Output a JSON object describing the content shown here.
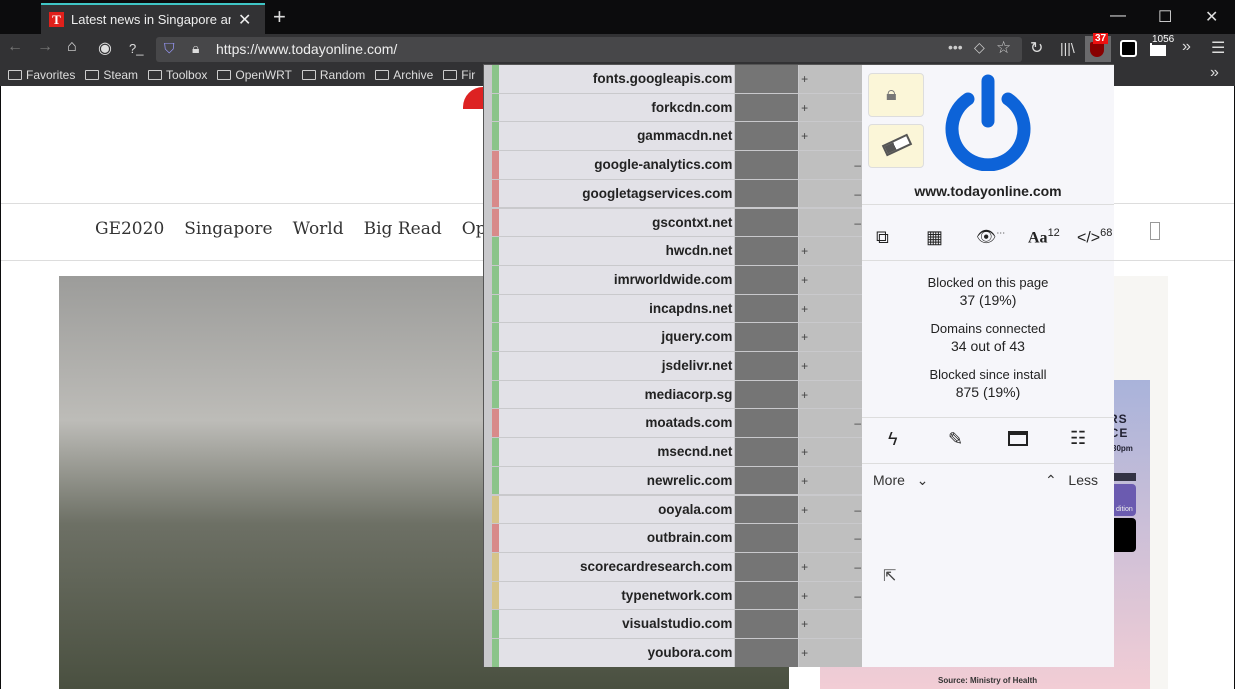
{
  "browser": {
    "tab_title": "Latest news in Singapore and around the world",
    "tab_favicon": "T",
    "url": "https://www.todayonline.com/",
    "ublock_badge": "37",
    "ext_badge": "1056",
    "bookmarks": [
      "Favorites",
      "Steam",
      "Toolbox",
      "OpenWRT",
      "Random",
      "Archive",
      "Fir"
    ]
  },
  "page": {
    "nav": [
      "GE2020",
      "Singapore",
      "World",
      "Big Read",
      "Opi"
    ],
    "ad_lines": [
      "ERS",
      "NCE",
      "30pm",
      "dition"
    ],
    "source": "Source: Ministry of Health"
  },
  "popup": {
    "domains": [
      {
        "name": "fonts.googleapis.com",
        "status": "allowed",
        "plus": true,
        "minus": false
      },
      {
        "name": "forkcdn.com",
        "status": "allowed",
        "plus": true,
        "minus": false
      },
      {
        "name": "gammacdn.net",
        "status": "allowed",
        "plus": true,
        "minus": false
      },
      {
        "name": "google-analytics.com",
        "status": "blocked",
        "plus": false,
        "minus": true
      },
      {
        "name": "googletagservices.com",
        "status": "blocked",
        "plus": false,
        "minus": true
      },
      {
        "name": "gscontxt.net",
        "status": "blocked",
        "plus": false,
        "minus": true
      },
      {
        "name": "hwcdn.net",
        "status": "allowed",
        "plus": true,
        "minus": false
      },
      {
        "name": "imrworldwide.com",
        "status": "allowed",
        "plus": true,
        "minus": false
      },
      {
        "name": "incapdns.net",
        "status": "allowed",
        "plus": true,
        "minus": false
      },
      {
        "name": "jquery.com",
        "status": "allowed",
        "plus": true,
        "minus": false
      },
      {
        "name": "jsdelivr.net",
        "status": "allowed",
        "plus": true,
        "minus": false
      },
      {
        "name": "mediacorp.sg",
        "status": "allowed",
        "plus": true,
        "minus": false
      },
      {
        "name": "moatads.com",
        "status": "blocked",
        "plus": false,
        "minus": true
      },
      {
        "name": "msecnd.net",
        "status": "allowed",
        "plus": true,
        "minus": false
      },
      {
        "name": "newrelic.com",
        "status": "allowed",
        "plus": true,
        "minus": false
      },
      {
        "name": "ooyala.com",
        "status": "partial",
        "plus": true,
        "minus": true
      },
      {
        "name": "outbrain.com",
        "status": "blocked",
        "plus": false,
        "minus": true
      },
      {
        "name": "scorecardresearch.com",
        "status": "partial",
        "plus": true,
        "minus": true
      },
      {
        "name": "typenetwork.com",
        "status": "partial",
        "plus": true,
        "minus": true
      },
      {
        "name": "visualstudio.com",
        "status": "allowed",
        "plus": true,
        "minus": false
      },
      {
        "name": "youbora.com",
        "status": "allowed",
        "plus": true,
        "minus": false
      }
    ],
    "colors": {
      "allowed": "#8bc48a",
      "blocked": "#d88a8a",
      "partial": "#d6c48a",
      "power": "#0d63d8"
    },
    "hostname": "www.todayonline.com",
    "fonts_count": "12",
    "scripts_count": "68",
    "cosmetic_suffix": "···",
    "stats": [
      {
        "label": "Blocked on this page",
        "value": "37 (19%)"
      },
      {
        "label": "Domains connected",
        "value": "34 out of 43"
      },
      {
        "label": "Blocked since install",
        "value": "875 (19%)"
      }
    ],
    "more": "More",
    "less": "Less"
  }
}
